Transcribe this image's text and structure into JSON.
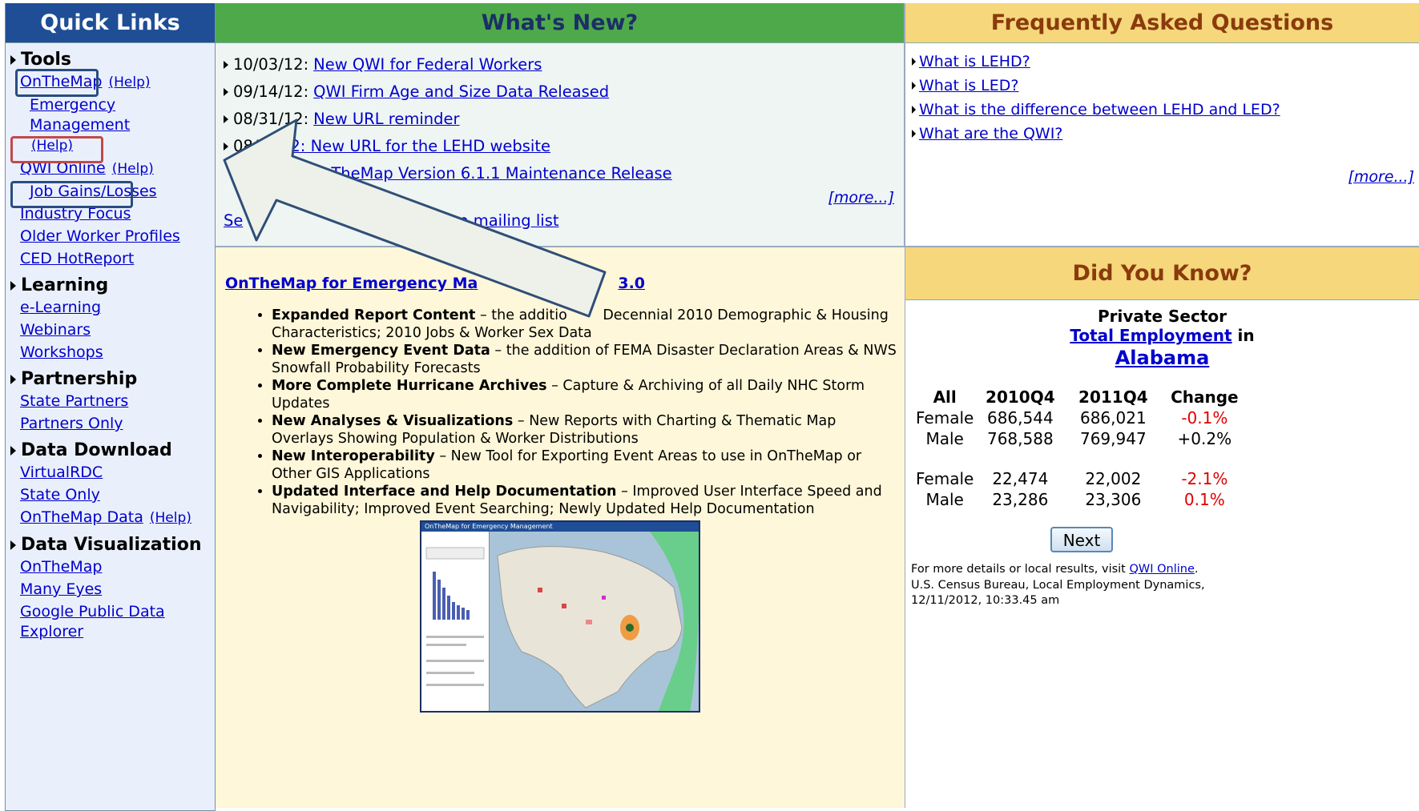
{
  "quick_links": {
    "title": "Quick Links",
    "tools": "Tools",
    "onthemap": "OnTheMap",
    "help": "(Help)",
    "emergency": "Emergency Management",
    "qwi_online": "QWI Online",
    "job_gains": "Job Gains/Losses",
    "industry_focus": "Industry Focus",
    "older_worker": "Older Worker Profiles",
    "ced": "CED HotReport",
    "learning": "Learning",
    "elearning": "e-Learning",
    "webinars": "Webinars",
    "workshops": "Workshops",
    "partnership": "Partnership",
    "state_partners": "State Partners",
    "partners_only": "Partners Only",
    "data_download": "Data Download",
    "virtualrdc": "VirtualRDC",
    "state_only": "State Only",
    "otm_data": "OnTheMap Data",
    "data_vis": "Data Visualization",
    "dv_onthemap": "OnTheMap",
    "many_eyes": "Many Eyes",
    "google_public": "Google Public Data",
    "explorer": "Explorer"
  },
  "whats_new": {
    "title": "What's New?",
    "items": [
      {
        "date": "10/03/12:",
        "text": "New QWI for Federal Workers"
      },
      {
        "date": "09/14/12:",
        "text": "QWI Firm Age and Size Data Released"
      },
      {
        "date": "08/31/12:",
        "text": "New URL reminder"
      },
      {
        "date": "08/",
        "text": "2: New URL for the LEHD website"
      },
      {
        "date": "",
        "text": "nTheMap Version 6.1.1 Maintenance Release"
      }
    ],
    "more": "[more...]",
    "mail_left": "Se",
    "mail_right": "Map mailing list"
  },
  "faq": {
    "title": "Frequently Asked Questions",
    "items": [
      "What is LEHD?",
      "What is LED?",
      "What is the difference between LEHD and LED?",
      "What are the QWI?"
    ],
    "more": "[more...]"
  },
  "feature": {
    "heading_left": "OnTheMap for Emergency Ma",
    "heading_right": "3.0",
    "bullets": [
      {
        "bold": "Expanded Report Content",
        "text": " – the additio        Decennial 2010 Demographic & Housing Characteristics; 2010 Jobs & Worker Sex Data"
      },
      {
        "bold": "New Emergency Event Data",
        "text": " – the addition of FEMA Disaster Declaration Areas & NWS Snowfall Probability Forecasts"
      },
      {
        "bold": "More Complete Hurricane Archives",
        "text": " – Capture & Archiving of all Daily NHC Storm Updates"
      },
      {
        "bold": "New Analyses & Visualizations",
        "text": " – New Reports with Charting & Thematic Map Overlays Showing Population & Worker Distributions"
      },
      {
        "bold": "New Interoperability",
        "text": " – New Tool for Exporting Event Areas to use in OnTheMap or Other GIS Applications"
      },
      {
        "bold": "Updated Interface and Help Documentation",
        "text": " – Improved User Interface Speed and Navigability; Improved Event Searching; Newly Updated Help Documentation"
      }
    ],
    "thumb_title": "OnTheMap for Emergency Management"
  },
  "did_you_know": {
    "title": "Did You Know?",
    "line1": "Private Sector",
    "metric": "Total Employment",
    "in": " in",
    "state": "Alabama",
    "headers": [
      "All",
      "2010Q4",
      "2011Q4",
      "Change"
    ],
    "rows": [
      [
        "Female",
        "686,544",
        "686,021",
        "-0.1%"
      ],
      [
        "Male",
        "768,588",
        "769,947",
        "+0.2%"
      ],
      [
        "Female",
        "22,474",
        "22,002",
        "-2.1%"
      ],
      [
        "Male",
        "23,286",
        "23,306",
        "0.1%"
      ]
    ],
    "next": "Next",
    "foot1": "For more details or local results, visit ",
    "foot_link": "QWI Online",
    "foot1_end": ".",
    "foot2": "U.S. Census Bureau, Local Employment Dynamics,",
    "foot3": "12/11/2012, 10:33.45 am"
  },
  "colors": {
    "navy": "#1f4e96",
    "green": "#4ea94a",
    "gold": "#f6d77c",
    "link": "#0000cc",
    "negative": "#e00000"
  }
}
